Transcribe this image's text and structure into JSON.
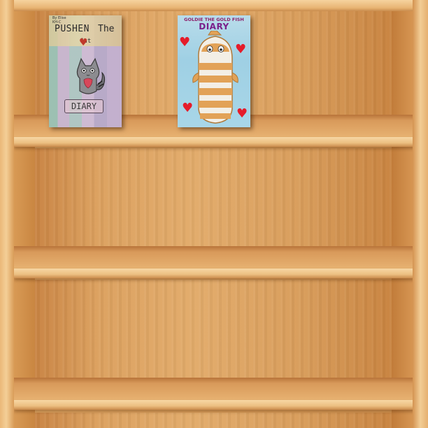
{
  "books": [
    {
      "author_line1": "By Elise",
      "author_line2": "KH-C",
      "title_word1": "PUSHEN",
      "title_word2": "The",
      "title_word3": "Cat",
      "subtitle": "DIARY"
    },
    {
      "title_small": "GOLDIE THE GOLD FISH",
      "title_big": "DIARY"
    }
  ],
  "icons": {
    "heart": "heart-icon",
    "cat": "cat-illustration",
    "fish": "fish-illustration"
  },
  "colors": {
    "wood": "#d99a55",
    "heart": "#e51c2a",
    "goldie_title": "#7a1f8a"
  }
}
